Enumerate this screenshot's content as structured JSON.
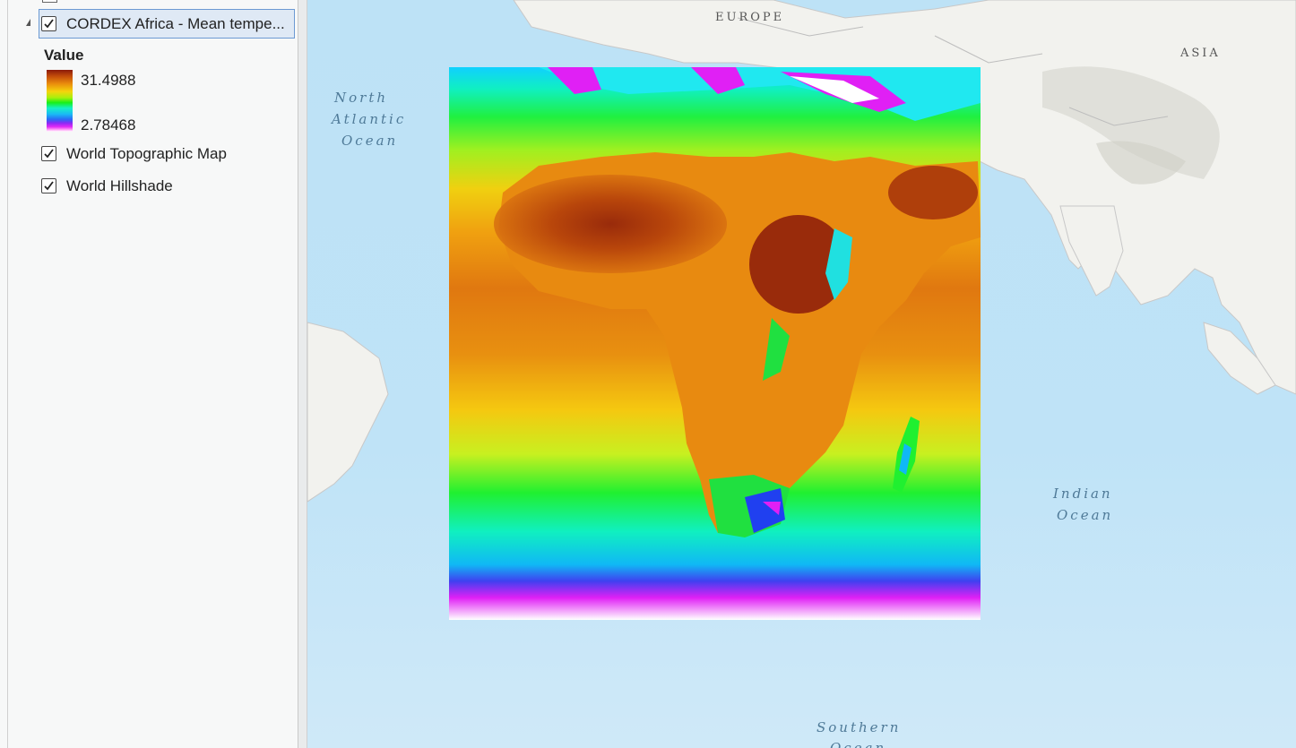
{
  "contents": {
    "layers": [
      {
        "label": "CORDEX Africa - Mean tempe...",
        "checked": true,
        "selected": true,
        "expanded": true
      },
      {
        "label": "World Topographic Map",
        "checked": true
      },
      {
        "label": "World Hillshade",
        "checked": true
      }
    ],
    "legend": {
      "title": "Value",
      "max": "31.4988",
      "min": "2.78468",
      "ramp_colors": [
        "#8b1a0a",
        "#e98a0c",
        "#f5d40c",
        "#18f018",
        "#15f0c8",
        "#2a6af5",
        "#e02af5",
        "#ffffff"
      ]
    }
  },
  "map": {
    "labels": {
      "north_atlantic": [
        "North",
        "Atlantic",
        "Ocean"
      ],
      "indian_ocean": [
        "Indian",
        "Ocean"
      ],
      "southern_ocean": [
        "Southern",
        "Ocean"
      ],
      "europe": "EUROPE",
      "asia": "ASIA"
    },
    "colors": {
      "ocean": "#c3e4f7",
      "land": "#f2f2ee"
    }
  }
}
